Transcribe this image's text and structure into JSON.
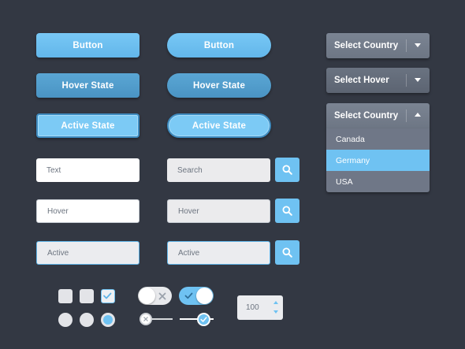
{
  "buttons": {
    "button_label": "Button",
    "hover_label": "Hover State",
    "active_label": "Active State"
  },
  "inputs": {
    "text_placeholder": "Text",
    "search_placeholder": "Search",
    "hover_value": "Hover",
    "hover_search_value": "Hover",
    "active_value": "Active",
    "active_search_value": "Active"
  },
  "dropdowns": {
    "select_country_label": "Select Country",
    "select_hover_label": "Select Hover",
    "open_label": "Select Country",
    "options": [
      "Canada",
      "Germany",
      "USA"
    ],
    "selected": "Germany"
  },
  "stepper": {
    "value": "100"
  },
  "colors": {
    "background": "#333843",
    "accent": "#6fc2f2",
    "hover": "#4f9bcb",
    "dropdown": "#737c8b"
  },
  "icons": [
    "search-icon",
    "close-icon",
    "check-icon",
    "chevron-down-icon",
    "chevron-up-icon"
  ]
}
